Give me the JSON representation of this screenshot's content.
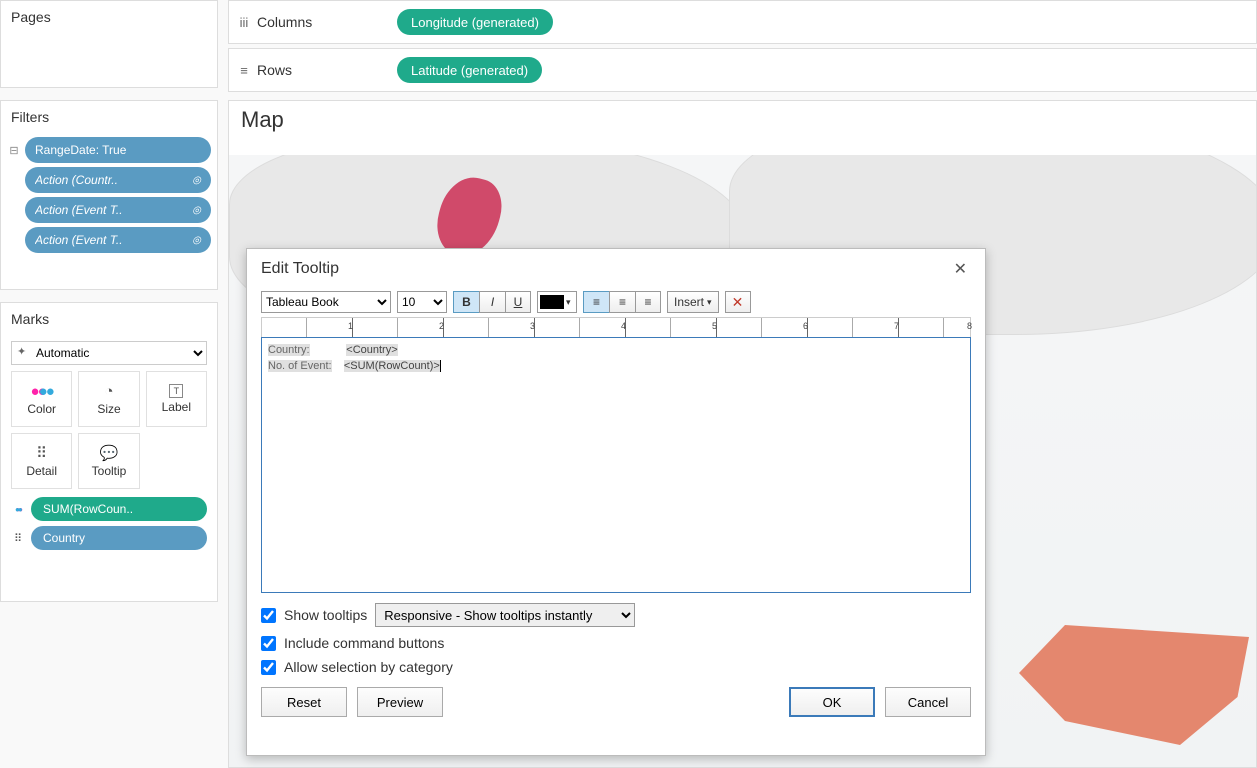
{
  "shelves": {
    "columns_label": "Columns",
    "rows_label": "Rows",
    "columns_pill": "Longitude (generated)",
    "rows_pill": "Latitude (generated)"
  },
  "panels": {
    "pages": "Pages",
    "filters": "Filters",
    "marks": "Marks"
  },
  "filters": {
    "items": [
      {
        "label": "RangeDate: True",
        "italic": false,
        "target": false,
        "set": true
      },
      {
        "label": "Action (Countr..",
        "italic": true,
        "target": true,
        "set": false
      },
      {
        "label": "Action (Event T..",
        "italic": true,
        "target": true,
        "set": false
      },
      {
        "label": "Action (Event T..",
        "italic": true,
        "target": true,
        "set": false
      }
    ]
  },
  "marks": {
    "type_value": "Automatic",
    "cells": {
      "color": "Color",
      "size": "Size",
      "label": "Label",
      "detail": "Detail",
      "tooltip": "Tooltip"
    },
    "pills": [
      {
        "label": "SUM(RowCoun..",
        "style": "green",
        "icon": "color"
      },
      {
        "label": "Country",
        "style": "blue",
        "icon": "detail"
      }
    ]
  },
  "viz": {
    "title": "Map"
  },
  "modal": {
    "title": "Edit Tooltip",
    "toolbar": {
      "font": "Tableau Book",
      "size": "10",
      "insert": "Insert"
    },
    "ruler_ticks": [
      "1",
      "2",
      "3",
      "4",
      "5",
      "6",
      "7",
      "8"
    ],
    "editor": {
      "line1_label": "Country:",
      "line1_field": "<Country>",
      "line2_label": "No. of Event:",
      "line2_field": "<SUM(RowCount)>"
    },
    "options": {
      "show_tooltips": "Show tooltips",
      "show_mode": "Responsive - Show tooltips instantly",
      "include_cmd": "Include command buttons",
      "allow_sel": "Allow selection by category"
    },
    "buttons": {
      "reset": "Reset",
      "preview": "Preview",
      "ok": "OK",
      "cancel": "Cancel"
    }
  }
}
